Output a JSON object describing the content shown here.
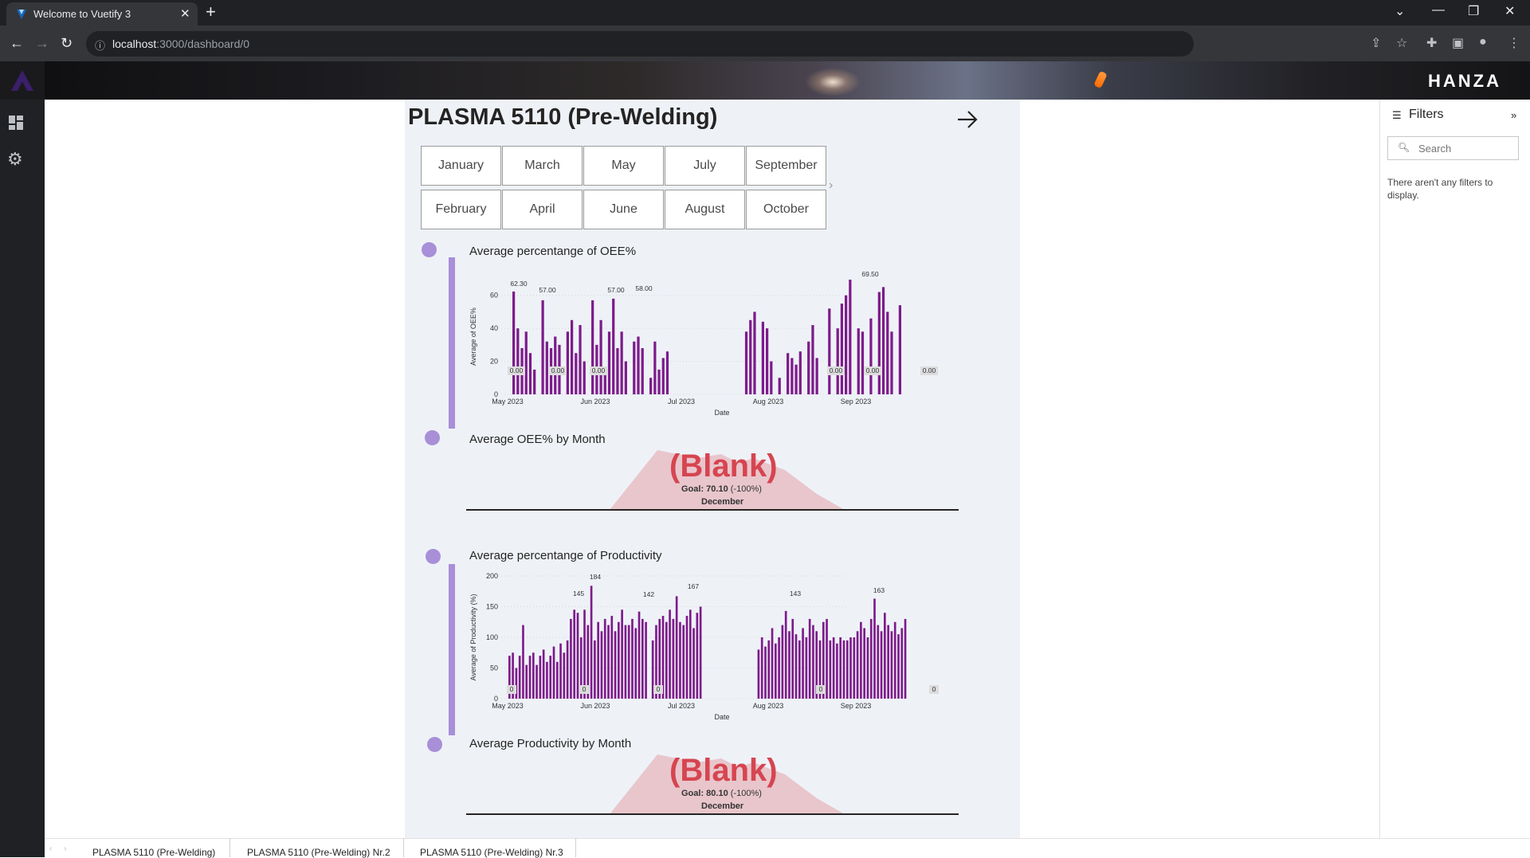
{
  "browser": {
    "tab_title": "Welcome to Vuetify 3",
    "url_host": "localhost",
    "url_path": ":3000/dashboard/0"
  },
  "app": {
    "brand": "HANZA"
  },
  "report": {
    "title": "PLASMA 5110 (Pre-Welding)",
    "months_row1": [
      "January",
      "March",
      "May",
      "July",
      "September"
    ],
    "months_row2": [
      "February",
      "April",
      "June",
      "August",
      "October"
    ],
    "section1_title": "Average percentange of OEE%",
    "section2_title": "Average OEE% by Month",
    "section3_title": "Average percentange of Productivity",
    "section4_title": "Average Productivity by Month",
    "gauge1": {
      "value": "(Blank)",
      "goal": "Goal: 70.10",
      "delta": "(-100%)",
      "label": "December"
    },
    "gauge2": {
      "value": "(Blank)",
      "goal": "Goal: 80.10",
      "delta": "(-100%)",
      "label": "December"
    }
  },
  "chart_data": [
    {
      "type": "bar",
      "ylabel": "Average of OEE%",
      "xlabel": "Date",
      "ylim": [
        0,
        70
      ],
      "yticks": [
        "0",
        "20",
        "40",
        "60"
      ],
      "xticks": [
        "May 2023",
        "Jun 2023",
        "Jul 2023",
        "Aug 2023",
        "Sep 2023"
      ],
      "color": "#7d1b8a",
      "values": [
        62.3,
        40,
        28,
        38,
        25,
        15,
        0,
        57,
        32,
        28,
        35,
        30,
        0,
        38,
        45,
        25,
        42,
        20,
        0,
        57,
        30,
        45,
        12,
        38,
        58,
        28,
        38,
        20,
        0,
        32,
        35,
        28,
        0,
        10,
        32,
        15,
        22,
        26,
        0,
        0,
        0,
        0,
        0,
        0,
        0,
        0,
        0,
        0,
        0,
        0,
        0,
        0,
        0,
        0,
        0,
        0,
        38,
        45,
        50,
        0,
        44,
        40,
        20,
        0,
        10,
        0,
        25,
        22,
        18,
        26,
        0,
        32,
        42,
        22,
        0,
        0,
        52,
        0,
        40,
        55,
        60,
        69.5,
        0,
        40,
        38,
        0,
        46,
        0,
        62,
        65,
        50,
        38,
        0,
        54
      ],
      "value_labels": [
        "62.30",
        "57.00",
        "57.00",
        "58.00",
        "69.50",
        "0.00",
        "0.00",
        "0.00",
        "0.00",
        "0.00",
        "0.00"
      ]
    },
    {
      "type": "bar",
      "ylabel": "Average of Productivity (%)",
      "xlabel": "Date",
      "ylim": [
        0,
        200
      ],
      "yticks": [
        "0",
        "50",
        "100",
        "150",
        "200"
      ],
      "xticks": [
        "May 2023",
        "Jun 2023",
        "Jul 2023",
        "Aug 2023",
        "Sep 2023"
      ],
      "color": "#7d1b8a",
      "values": [
        70,
        75,
        50,
        70,
        120,
        55,
        70,
        75,
        55,
        70,
        80,
        60,
        70,
        85,
        60,
        90,
        75,
        95,
        130,
        145,
        140,
        100,
        145,
        120,
        184,
        95,
        125,
        110,
        130,
        120,
        135,
        110,
        125,
        145,
        120,
        120,
        130,
        115,
        142,
        130,
        125,
        0,
        95,
        120,
        130,
        135,
        125,
        145,
        130,
        167,
        125,
        120,
        135,
        145,
        115,
        140,
        150,
        0,
        0,
        0,
        0,
        0,
        0,
        0,
        0,
        0,
        0,
        0,
        0,
        0,
        0,
        0,
        0,
        80,
        100,
        85,
        95,
        115,
        90,
        100,
        120,
        143,
        110,
        130,
        105,
        95,
        115,
        100,
        130,
        120,
        110,
        95,
        125,
        130,
        95,
        100,
        90,
        100,
        95,
        95,
        100,
        100,
        110,
        125,
        115,
        100,
        130,
        163,
        120,
        110,
        140,
        120,
        110,
        125,
        105,
        115,
        130
      ]
    }
  ],
  "filters": {
    "title": "Filters",
    "search_placeholder": "Search",
    "empty_text": "There aren't any filters to display."
  },
  "page_tabs": [
    "PLASMA 5110 (Pre-Welding)",
    "PLASMA 5110 (Pre-Welding) Nr.2",
    "PLASMA 5110 (Pre-Welding) Nr.3"
  ]
}
